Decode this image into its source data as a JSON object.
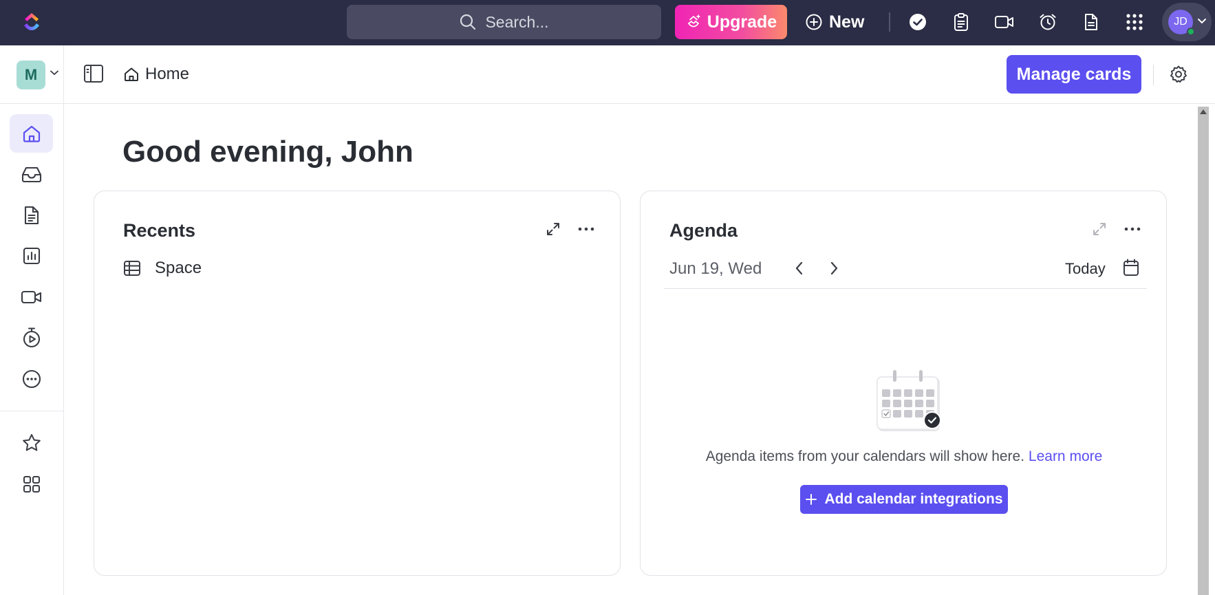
{
  "topbar": {
    "search_placeholder": "Search...",
    "upgrade_label": "Upgrade",
    "new_label": "New",
    "icons": [
      "check-circle-icon",
      "clipboard-icon",
      "video-icon",
      "alarm-clock-icon",
      "document-icon",
      "apps-grid-icon"
    ],
    "avatar_initials": "JD"
  },
  "sidebar": {
    "workspace_initial": "M",
    "items": [
      "home-icon",
      "inbox-icon",
      "docs-icon",
      "dashboards-icon",
      "clips-icon",
      "timesheets-icon",
      "more-icon",
      "favorites-icon",
      "spaces-icon"
    ]
  },
  "header": {
    "breadcrumb": "Home",
    "manage_cards_label": "Manage cards"
  },
  "main": {
    "greeting": "Good evening, John"
  },
  "recents": {
    "title": "Recents",
    "items": [
      {
        "label": "Space",
        "icon": "table-icon"
      }
    ]
  },
  "agenda": {
    "title": "Agenda",
    "date": "Jun 19, Wed",
    "today_label": "Today",
    "empty_message": "Agenda items from your calendars will show here.",
    "learn_more": "Learn more",
    "add_button": "Add calendar integrations"
  },
  "colors": {
    "topbar_bg": "#2b2c45",
    "accent": "#5b4ff0",
    "upgrade_gradient_start": "#f024b4",
    "upgrade_gradient_end": "#fb8a6c"
  }
}
